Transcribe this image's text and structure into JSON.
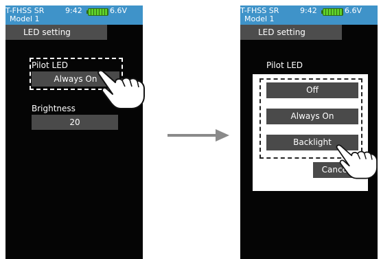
{
  "screens": {
    "left": {
      "status": {
        "system": "T-FHSS SR",
        "time": "9:42",
        "voltage": "6.6V",
        "model": "Model 1"
      },
      "tab_label": "LED setting",
      "pilot_led": {
        "label": "Pilot LED",
        "value": "Always On"
      },
      "brightness": {
        "label": "Brightness",
        "value": "20"
      }
    },
    "right": {
      "status": {
        "system": "T-FHSS SR",
        "time": "9:42",
        "voltage": "6.6V",
        "model": "Model 1"
      },
      "tab_label": "LED setting",
      "pilot_led_label": "Pilot LED",
      "options": [
        "Off",
        "Always On",
        "Backlight"
      ],
      "cancel_label": "Cancel"
    }
  },
  "colors": {
    "status_bar": "#3f93c9",
    "screen_bg": "#050505",
    "button_bg": "#4a4a4a",
    "battery": "#5fd12a",
    "arrow": "#8a8a8a"
  },
  "icons": [
    "battery-icon",
    "pointing-hand-icon",
    "right-arrow-icon"
  ]
}
